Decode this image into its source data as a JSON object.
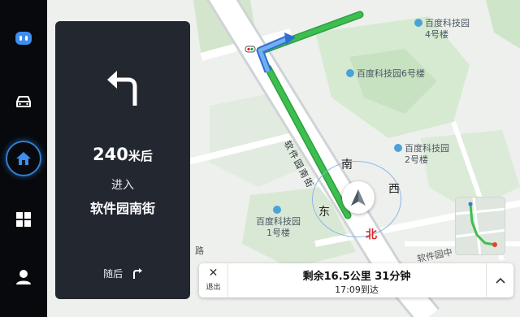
{
  "sidebar": {
    "items": [
      {
        "name": "voice-assistant",
        "icon": "assistant-icon"
      },
      {
        "name": "vehicle",
        "icon": "car-icon"
      },
      {
        "name": "home",
        "icon": "home-icon",
        "active": true
      },
      {
        "name": "apps",
        "icon": "grid-icon"
      },
      {
        "name": "profile",
        "icon": "user-icon"
      }
    ],
    "accent": "#2f7fd6"
  },
  "guidance": {
    "maneuver_icon": "turn-left-arrow-icon",
    "distance_value": "240",
    "distance_unit": "米后",
    "action": "进入",
    "road": "软件园南街",
    "next_label": "随后",
    "next_icon": "turn-right-arrow-icon"
  },
  "map": {
    "pois": [
      {
        "name": "百度科技园",
        "sub": "4号楼"
      },
      {
        "name": "百度科技园6号楼"
      },
      {
        "name": "百度科技园",
        "sub": "2号楼"
      },
      {
        "name": "百度科技园",
        "sub": "1号楼"
      }
    ],
    "road_labels": [
      "软件园南街",
      "软件园中",
      "路"
    ],
    "route_color": "#35b24a",
    "route_upcoming_color": "#3a87e6"
  },
  "compass": {
    "north": "北",
    "south": "南",
    "east": "东",
    "west": "西"
  },
  "trip": {
    "exit_label": "退出",
    "remaining": "剩余16.5公里 31分钟",
    "eta": "17:09到达"
  }
}
